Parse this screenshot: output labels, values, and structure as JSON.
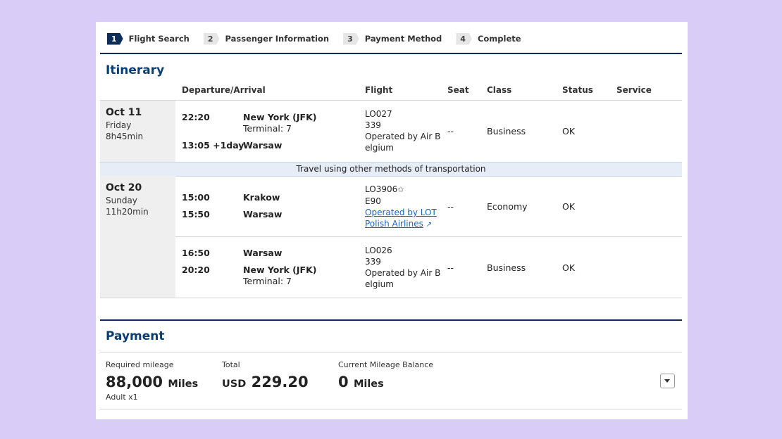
{
  "steps": [
    {
      "num": "1",
      "label": "Flight Search"
    },
    {
      "num": "2",
      "label": "Passenger Information"
    },
    {
      "num": "3",
      "label": "Payment Method"
    },
    {
      "num": "4",
      "label": "Complete"
    }
  ],
  "itinerary": {
    "title": "Itinerary",
    "headers": {
      "departure_arrival": "Departure/Arrival",
      "flight": "Flight",
      "seat": "Seat",
      "class": "Class",
      "status": "Status",
      "service": "Service"
    },
    "day1": {
      "date": "Oct 11",
      "weekday": "Friday",
      "duration": "8h45min",
      "segment": {
        "dep_time": "22:20",
        "dep_city": "New York (JFK)",
        "dep_terminal": "Terminal: 7",
        "arr_time": "13:05 +1day",
        "arr_city": "Warsaw",
        "flight_no": "LO027",
        "aircraft": "339",
        "operated": "Operated by Air B elgium",
        "seat": "--",
        "class": "Business",
        "status": "OK"
      }
    },
    "transport_note": "Travel using other methods of transportation",
    "day2": {
      "date": "Oct 20",
      "weekday": "Sunday",
      "duration": "11h20min",
      "segment1": {
        "dep_time": "15:00",
        "dep_city": "Krakow",
        "arr_time": "15:50",
        "arr_city": "Warsaw",
        "flight_no": "LO3906",
        "aircraft": "E90",
        "operated_link_1": "Operated by LOT",
        "operated_link_2": "Polish Airlines",
        "seat": "--",
        "class": "Economy",
        "status": "OK"
      },
      "segment2": {
        "dep_time": "16:50",
        "dep_city": "Warsaw",
        "arr_time": "20:20",
        "arr_city": "New York (JFK)",
        "arr_terminal": "Terminal: 7",
        "flight_no": "LO026",
        "aircraft": "339",
        "operated": "Operated by Air B elgium",
        "seat": "--",
        "class": "Business",
        "status": "OK"
      }
    }
  },
  "payment": {
    "title": "Payment",
    "required_mileage_label": "Required mileage",
    "required_mileage_value": "88,000",
    "required_mileage_unit": "Miles",
    "passengers": "Adult x1",
    "total_label": "Total",
    "total_currency": "USD",
    "total_value": "229.20",
    "balance_label": "Current Mileage Balance",
    "balance_value": "0",
    "balance_unit": "Miles"
  }
}
